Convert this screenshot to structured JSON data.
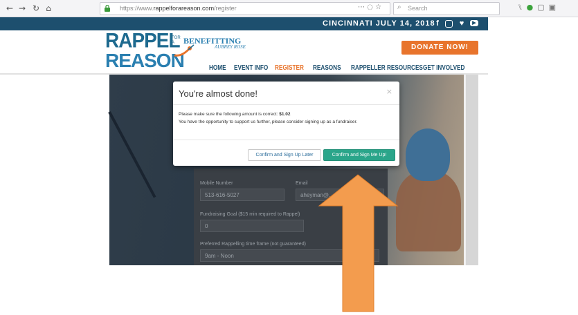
{
  "browser": {
    "url_host": "https://www.",
    "url_domain": "rappelforareason.com",
    "url_path": "/register",
    "search_placeholder": "Search"
  },
  "site": {
    "topbar": "CINCINNATI JULY 14, 2018",
    "logo_top": "RAPPEL",
    "logo_for": "FOR\nA",
    "logo_bottom": "REASON",
    "benefitting": "BENEFITTING",
    "beneficiary": "AUBREY ROSE",
    "donate": "DONATE NOW!",
    "nav": [
      "HOME",
      "EVENT INFO",
      "REGISTER",
      "REASONS",
      "RAPPELLER RESOURCES",
      "GET INVOLVED"
    ],
    "active_nav_index": 2
  },
  "form": {
    "mobile_label": "Mobile Number",
    "mobile_value": "513-616-5027",
    "email_label": "Email",
    "email_value": "aheyman@...",
    "goal_label": "Fundraising Goal ($15 min required to Rappel)",
    "goal_value": "0",
    "time_label": "Preferred Rappelling time frame (not guaranteed)",
    "time_value": "9am - Noon"
  },
  "modal": {
    "title": "You're almost done!",
    "close": "×",
    "line1_prefix": "Please make sure the following amount is correct:",
    "amount": "$1.02",
    "line2": "You have the opportunity to support us further, please consider signing up as a fundraiser.",
    "later_button": "Confirm and Sign Up Later",
    "now_button": "Confirm and Sign Me Up!"
  },
  "colors": {
    "accent_orange": "#F39C4E",
    "brand_blue": "#1D4F6E",
    "button_green": "#2AA58A"
  }
}
